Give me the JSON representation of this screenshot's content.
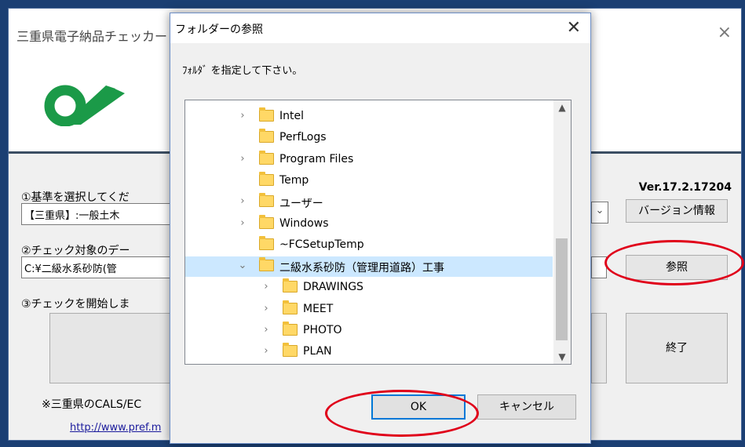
{
  "main": {
    "title": "三重県電子納品チェッカー",
    "close_glyph": "×",
    "version": "Ver.17.2.17204",
    "step1_label": "①基準を選択してくだ",
    "standard_value": "【三重県】:一般土木",
    "version_info_button": "バージョン情報",
    "step2_label": "②チェック対象のデー",
    "path_value": "C:¥二級水系砂防(管",
    "browse_button": "参照",
    "step3_label": "③チェックを開始しま",
    "exit_button": "終了",
    "note": "※三重県のCALS/EC",
    "link": "http://www.pref.m"
  },
  "dialog": {
    "title": "フォルダーの参照",
    "close_glyph": "✕",
    "instruction": "ﾌｫﾙﾀﾞ を指定して下さい。",
    "tree": [
      {
        "label": "Intel",
        "expandable": true,
        "level": 0,
        "selected": false,
        "expanded": false
      },
      {
        "label": "PerfLogs",
        "expandable": false,
        "level": 0,
        "selected": false,
        "expanded": false
      },
      {
        "label": "Program Files",
        "expandable": true,
        "level": 0,
        "selected": false,
        "expanded": false
      },
      {
        "label": "Temp",
        "expandable": false,
        "level": 0,
        "selected": false,
        "expanded": false
      },
      {
        "label": "ユーザー",
        "expandable": true,
        "level": 0,
        "selected": false,
        "expanded": false
      },
      {
        "label": "Windows",
        "expandable": true,
        "level": 0,
        "selected": false,
        "expanded": false
      },
      {
        "label": "~FCSetupTemp",
        "expandable": false,
        "level": 0,
        "selected": false,
        "expanded": false
      },
      {
        "label": "二級水系砂防（管理用道路）工事",
        "expandable": true,
        "level": 0,
        "selected": true,
        "expanded": true
      },
      {
        "label": "DRAWINGS",
        "expandable": true,
        "level": 1,
        "selected": false,
        "expanded": false
      },
      {
        "label": "MEET",
        "expandable": true,
        "level": 1,
        "selected": false,
        "expanded": false
      },
      {
        "label": "PHOTO",
        "expandable": true,
        "level": 1,
        "selected": false,
        "expanded": false
      },
      {
        "label": "PLAN",
        "expandable": true,
        "level": 1,
        "selected": false,
        "expanded": false
      }
    ],
    "ok_button": "OK",
    "cancel_button": "キャンセル"
  },
  "icons": {
    "collapsed": "chevron-right-icon",
    "expanded": "chevron-down-icon",
    "folder": "folder-icon",
    "logo": "mie-prefecture-logo"
  },
  "colors": {
    "logo_green": "#1b9a48",
    "selection": "#cce8ff",
    "highlight_ring": "#e0001a",
    "ok_border": "#0078d7"
  }
}
